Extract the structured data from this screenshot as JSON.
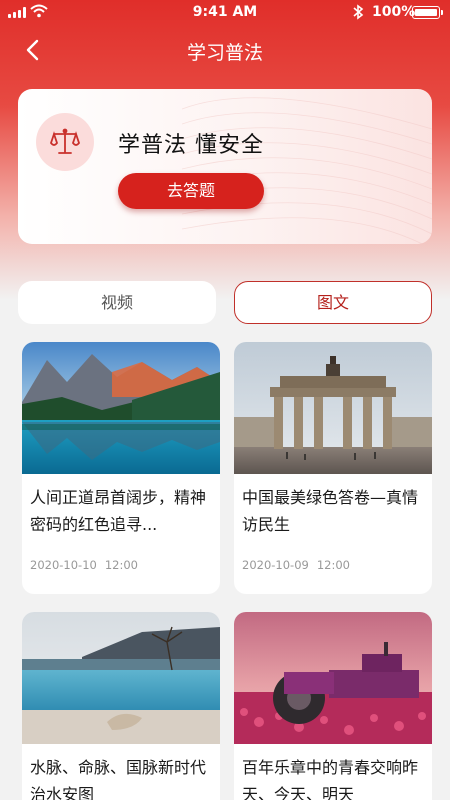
{
  "status_bar": {
    "time": "9:41 AM",
    "battery": "100%",
    "icons": [
      "signal-icon",
      "wifi-icon",
      "bluetooth-icon",
      "battery-icon"
    ]
  },
  "nav": {
    "title": "学习普法",
    "back_icon": "chevron-left-icon"
  },
  "hero": {
    "title": "学普法 懂安全",
    "button_label": "去答题",
    "icon": "scales-of-justice-icon"
  },
  "tabs": [
    {
      "label": "视频",
      "selected": false
    },
    {
      "label": "图文",
      "selected": true
    }
  ],
  "articles": [
    {
      "title": "人间正道昂首阔步，精神密码的红色追寻...",
      "date": "2020-10-10",
      "time": "12:00",
      "image": "mountain lake photo"
    },
    {
      "title": "中国最美绿色答卷—真情访民生",
      "date": "2020-10-09",
      "time": "12:00",
      "image": "brandenburg gate photo"
    },
    {
      "title": "水脉、命脉、国脉新时代治水安图",
      "date": "",
      "time": "",
      "image": "infinity pool seaside photo"
    },
    {
      "title": "百年乐章中的青春交响昨天、今天、明天",
      "date": "",
      "time": "",
      "image": "tractor in flower field photo"
    }
  ],
  "colors": {
    "primary": "#d6221d",
    "header_top": "#e02e2a",
    "background": "#f2f2f2",
    "meta_text": "#999999"
  }
}
